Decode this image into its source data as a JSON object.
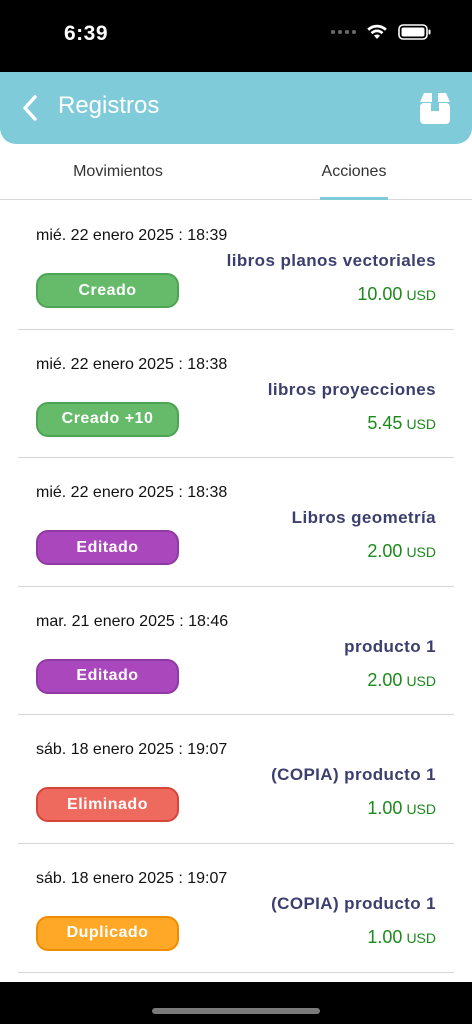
{
  "status_bar": {
    "time": "6:39"
  },
  "header": {
    "title": "Registros"
  },
  "tabs": [
    {
      "label": "Movimientos"
    },
    {
      "label": "Acciones"
    }
  ],
  "active_tab": "Acciones",
  "entries": [
    {
      "date": "mié. 22 enero 2025 : 18:39",
      "name": "libros planos vectoriales",
      "action": "Creado",
      "amount": "10.00",
      "currency": "USD",
      "color": "#66bb6a"
    },
    {
      "date": "mié. 22 enero 2025 : 18:38",
      "name": "libros proyecciones",
      "action": "Creado +10",
      "amount": "5.45",
      "currency": "USD",
      "color": "#66bb6a"
    },
    {
      "date": "mié. 22 enero 2025 : 18:38",
      "name": "Libros geometría",
      "action": "Editado",
      "amount": "2.00",
      "currency": "USD",
      "color": "#ab47bc"
    },
    {
      "date": "mar. 21 enero 2025 : 18:46",
      "name": "producto 1",
      "action": "Editado",
      "amount": "2.00",
      "currency": "USD",
      "color": "#ab47bc"
    },
    {
      "date": "sáb. 18 enero 2025 : 19:07",
      "name": "(COPIA) producto 1",
      "action": "Eliminado",
      "amount": "1.00",
      "currency": "USD",
      "color": "#ef6a5e"
    },
    {
      "date": "sáb. 18 enero 2025 : 19:07",
      "name": "(COPIA) producto 1",
      "action": "Duplicado",
      "amount": "1.00",
      "currency": "USD",
      "color": "#ffa726"
    }
  ],
  "colors": {
    "header_bg": "#7fcbd9",
    "price": "#1a8a1a",
    "name": "#3c3f6e"
  }
}
